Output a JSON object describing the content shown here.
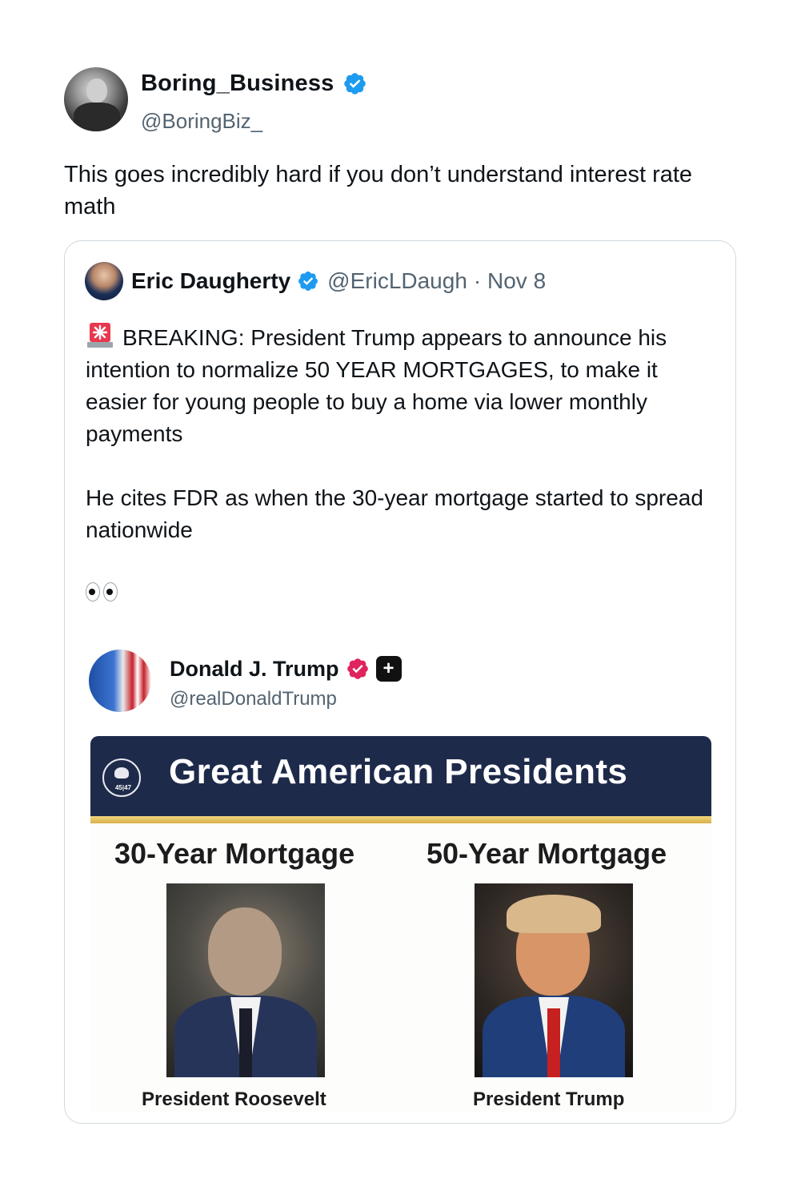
{
  "post": {
    "author_name": "Boring_Business",
    "author_handle": "@BoringBiz_",
    "text": "This goes incredibly hard if you don’t understand interest rate math"
  },
  "quote": {
    "author_name": "Eric Daugherty",
    "author_handle": "@EricLDaugh",
    "date": "· Nov 8",
    "paragraph1": "BREAKING: President Trump appears to announce his intention to normalize 50 YEAR MORTGAGES, to make it easier for young people to buy a home via lower monthly payments",
    "paragraph2": "He cites FDR as when the 30-year mortgage started to spread nationwide"
  },
  "embedded": {
    "author_name": "Donald J. Trump",
    "author_handle": "@realDonaldTrump",
    "plus_label": "+"
  },
  "poster": {
    "title": "Great American Presidents",
    "seal_text": "45|47",
    "left_heading": "30-Year Mortgage",
    "right_heading": "50-Year Mortgage",
    "left_caption": "President Roosevelt",
    "right_caption": "President Trump"
  },
  "colors": {
    "verified_blue": "#1d9bf0",
    "verified_pink": "#e0245e",
    "banner_navy": "#1e2a4a"
  },
  "icons": [
    "verified-icon",
    "siren-icon",
    "eyes-icon",
    "plus-badge-icon",
    "presidential-seal-icon"
  ]
}
